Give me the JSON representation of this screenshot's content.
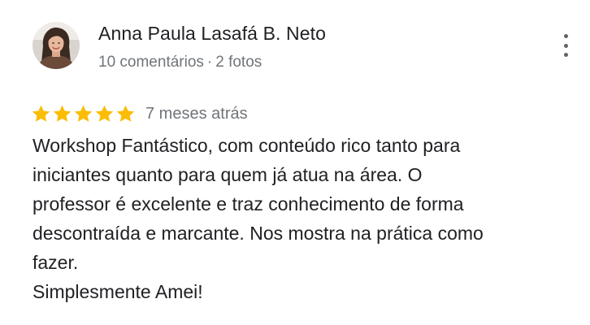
{
  "review": {
    "author": {
      "name": "Anna Paula Lasafá B. Neto",
      "comments": "10 comentários",
      "separator": "·",
      "photos": "2 fotos",
      "avatar_icon": "user-photo-avatar"
    },
    "menu_icon": "more-vert-icon",
    "rating": {
      "value": 5,
      "max": 5,
      "star_color": "#fbbc04",
      "time": "7 meses atrás"
    },
    "text_lines": [
      "Workshop Fantástico, com conteúdo rico tanto para",
      "iniciantes quanto para quem já atua na área. O",
      "professor é excelente e traz conhecimento de forma",
      "descontraída e marcante. Nos mostra na prática como",
      "fazer.",
      "Simplesmente Amei!"
    ]
  }
}
